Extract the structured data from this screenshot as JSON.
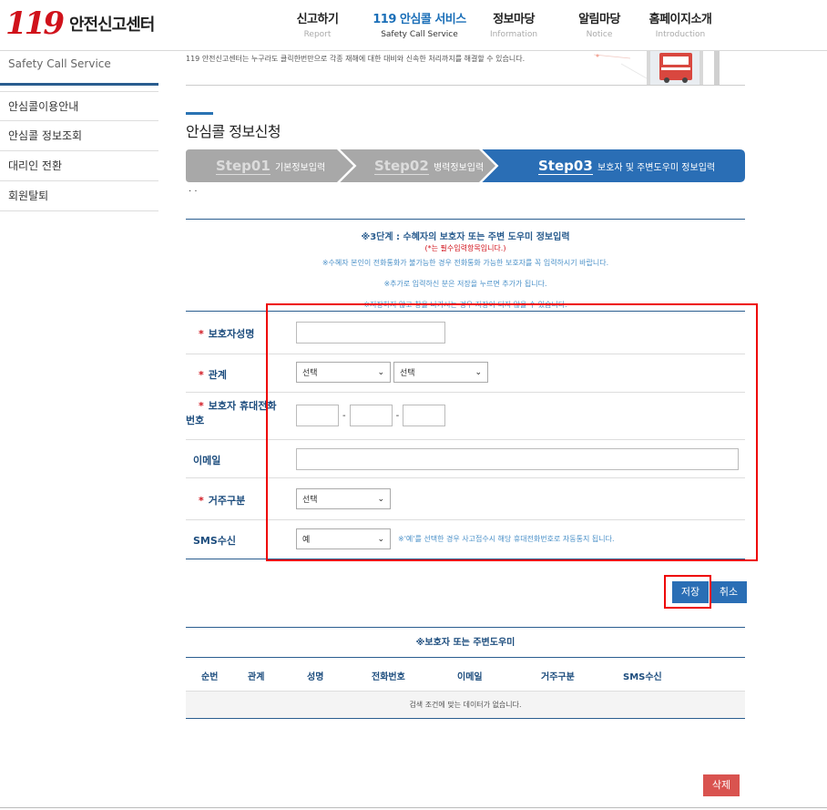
{
  "header": {
    "logo_mark": "119",
    "logo_text": "안전신고센터",
    "nav": [
      {
        "ko": "신고하기",
        "en": "Report"
      },
      {
        "ko": "119 안심콜 서비스",
        "en": "Safety Call Service"
      },
      {
        "ko": "정보마당",
        "en": "Information"
      },
      {
        "ko": "알림마당",
        "en": "Notice"
      },
      {
        "ko": "홈페이지소개",
        "en": "Introduction"
      }
    ]
  },
  "sidebar": {
    "title": "Safety Call Service",
    "items": [
      "안심콜이용안내",
      "안심콜 정보조회",
      "대리인 전환",
      "회원탈퇴"
    ]
  },
  "banner": {
    "text": "119 안전신고센터는 누구라도 클릭한번만으로 각종 재해에 대한 대비와 신속한 처리까지를 해결할 수 있습니다."
  },
  "page": {
    "title": "안심콜 정보신청",
    "dots": "· ·"
  },
  "steps": [
    {
      "num": "Step01",
      "label": "기본정보입력"
    },
    {
      "num": "Step02",
      "label": "병력정보입력"
    },
    {
      "num": "Step03",
      "label": "보호자 및 주변도우미 정보입력"
    }
  ],
  "guide": {
    "title": "※3단계 : 수혜자의 보호자 또는 주변 도우미 정보입력",
    "required": "(*는 필수입력항목입니다.)",
    "lines": [
      "※수혜자 본인이 전화통화가 불가능한 경우 전화통화 가능한 보호자를 꼭 입력하시기 바랍니다.",
      "※추가로 입력하신 분은 저장을 누르면 추가가 됩니다.",
      "※저장하지 않고 창을 나가시는 경우 저장이 되지 않을 수 있습니다."
    ]
  },
  "form": {
    "star": "*",
    "guardian_name_label": "보호자성명",
    "relation_label": "관계",
    "relation_select1": "선택",
    "relation_select2": "선택",
    "phone_label": "보호자 휴대전화 번호",
    "phone_hyphen": "-",
    "email_label": "이메일",
    "residence_label": "거주구분",
    "residence_select": "선택",
    "sms_label": "SMS수신",
    "sms_select": "예",
    "sms_note": "※'예'를 선택한 경우 사고접수시 해당 휴대전화번호로 자동통지 됩니다."
  },
  "buttons": {
    "save": "저장",
    "cancel": "취소",
    "delete": "삭제"
  },
  "list": {
    "title": "※보호자 또는 주변도우미",
    "columns": [
      "순번",
      "관계",
      "성명",
      "전화번호",
      "이메일",
      "거주구분",
      "SMS수신"
    ],
    "empty": "검색 조건에 맞는 데이터가 없습니다."
  },
  "colors": {
    "primary": "#2a6eb5",
    "step_inactive": "#a8a8a8",
    "accent_red": "#e00000",
    "delete": "#d9534f"
  }
}
